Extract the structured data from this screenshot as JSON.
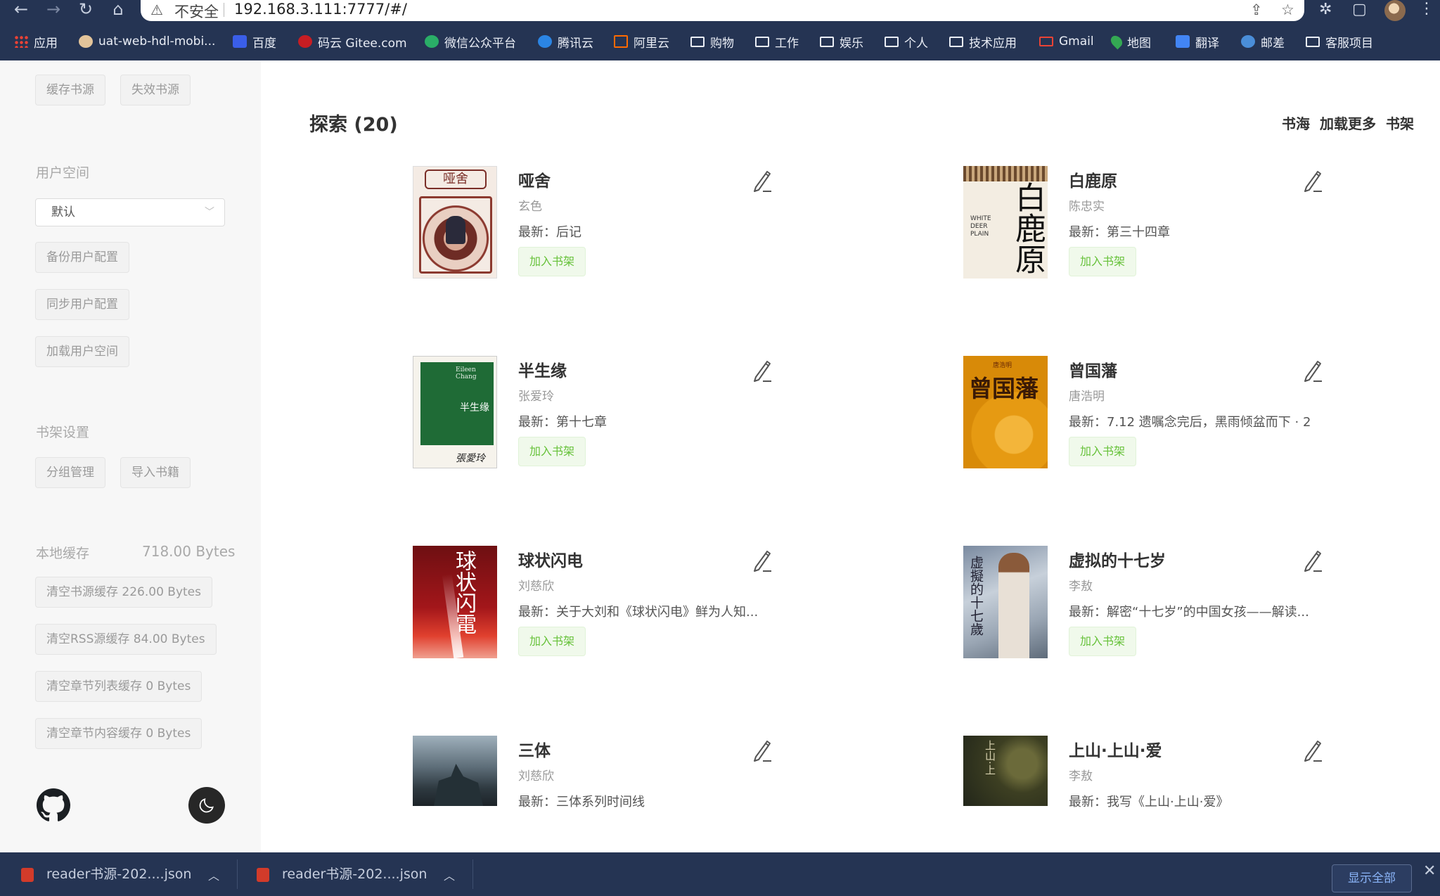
{
  "browser": {
    "insecure_label": "不安全",
    "url": "192.168.3.111:7777/#/",
    "bookmarks": [
      {
        "label": "应用",
        "icon": "apps-grid-icon"
      },
      {
        "label": "uat-web-hdl-mobi...",
        "icon": "site-icon"
      },
      {
        "label": "百度",
        "icon": "baidu-icon"
      },
      {
        "label": "码云 Gitee.com",
        "icon": "gitee-icon"
      },
      {
        "label": "微信公众平台",
        "icon": "wechat-icon"
      },
      {
        "label": "腾讯云",
        "icon": "tencent-cloud-icon"
      },
      {
        "label": "阿里云",
        "icon": "aliyun-icon"
      },
      {
        "label": "购物",
        "icon": "folder-icon"
      },
      {
        "label": "工作",
        "icon": "folder-icon"
      },
      {
        "label": "娱乐",
        "icon": "folder-icon"
      },
      {
        "label": "个人",
        "icon": "folder-icon"
      },
      {
        "label": "技术应用",
        "icon": "folder-icon"
      },
      {
        "label": "Gmail",
        "icon": "gmail-icon"
      },
      {
        "label": "地图",
        "icon": "maps-icon"
      },
      {
        "label": "翻译",
        "icon": "translate-icon"
      },
      {
        "label": "邮差",
        "icon": "postman-icon"
      },
      {
        "label": "客服项目",
        "icon": "folder-icon"
      }
    ]
  },
  "sidebar": {
    "source_buttons": {
      "cache": "缓存书源",
      "invalid": "失效书源"
    },
    "user_space": {
      "heading": "用户空间",
      "selected": "默认",
      "backup": "备份用户配置",
      "sync": "同步用户配置",
      "load": "加载用户空间"
    },
    "shelf_settings": {
      "heading": "书架设置",
      "groups": "分组管理",
      "import": "导入书籍"
    },
    "local_cache": {
      "heading": "本地缓存",
      "size": "718.00 Bytes",
      "clear_source": "清空书源缓存 226.00 Bytes",
      "clear_rss": "清空RSS源缓存 84.00 Bytes",
      "clear_chapter_list": "清空章节列表缓存 0 Bytes",
      "clear_chapter_content": "清空章节内容缓存 0 Bytes"
    }
  },
  "main": {
    "title": "探索 (20)",
    "links": {
      "sea": "书海",
      "more": "加载更多",
      "shelf": "书架"
    },
    "add_label": "加入书架",
    "books": [
      {
        "title": "哑舍",
        "author": "玄色",
        "latest": "最新：后记",
        "cover": "yashe"
      },
      {
        "title": "白鹿原",
        "author": "陈忠实",
        "latest": "最新：第三十四章",
        "cover": "bailuyuan"
      },
      {
        "title": "半生缘",
        "author": "张爱玲",
        "latest": "最新：第十七章",
        "cover": "banshengyuan"
      },
      {
        "title": "曾国藩",
        "author": "唐浩明",
        "latest": "最新：7.12 遗嘱念完后，黑雨倾盆而下 · 2",
        "cover": "zengguofan"
      },
      {
        "title": "球状闪电",
        "author": "刘慈欣",
        "latest": "最新：关于大刘和《球状闪电》鲜为人知...",
        "cover": "qiuzhuang"
      },
      {
        "title": "虚拟的十七岁",
        "author": "李敖",
        "latest": "最新：解密“十七岁”的中国女孩——解读...",
        "cover": "xuni"
      },
      {
        "title": "三体",
        "author": "刘慈欣",
        "latest": "最新：三体系列时间线",
        "cover": "santi"
      },
      {
        "title": "上山·上山·爱",
        "author": "李敖",
        "latest": "最新：我写《上山·上山·爱》",
        "cover": "shangshan"
      }
    ],
    "cover_text": {
      "yashe": "哑舍",
      "bailuyuan_cn": "白鹿原",
      "bailuyuan_en": "WHITE DEER PLAIN",
      "banshengyuan_en": "Eileen Chang",
      "banshengyuan_cn": "半生缘",
      "banshengyuan_sign": "張愛玲",
      "zengguofan_author": "唐浩明",
      "zengguofan_cn": "曾国藩",
      "qiuzhuang_cn": "球状闪電",
      "xuni_cn": "虚擬的十七歲",
      "shangshan_cn": "上山·上"
    }
  },
  "downloads": {
    "items": [
      "reader书源-202....json",
      "reader书源-202....json"
    ],
    "show_all": "显示全部"
  }
}
